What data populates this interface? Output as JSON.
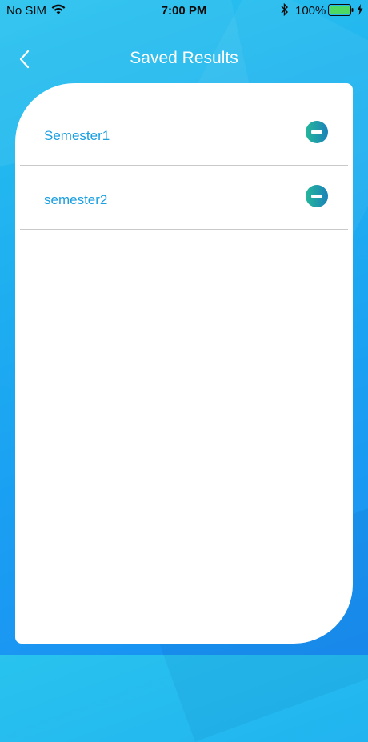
{
  "status_bar": {
    "carrier": "No SIM",
    "time": "7:00 PM",
    "battery_percent": "100%",
    "icons": [
      "wifi-icon",
      "bluetooth-icon",
      "battery-icon",
      "charging-bolt-icon"
    ]
  },
  "nav": {
    "title": "Saved Results",
    "back_icon": "chevron-left-icon"
  },
  "saved_results": {
    "items": [
      {
        "label": "Semester1",
        "action_icon": "remove-icon"
      },
      {
        "label": "semester2",
        "action_icon": "remove-icon"
      }
    ]
  },
  "colors": {
    "background_top": "#29c3ee",
    "background_bottom": "#1a8ff2",
    "label_text": "#1a9fe0",
    "remove_gradient_start": "#26b79a",
    "remove_gradient_end": "#1a82b8",
    "battery_fill": "#4cd964"
  }
}
